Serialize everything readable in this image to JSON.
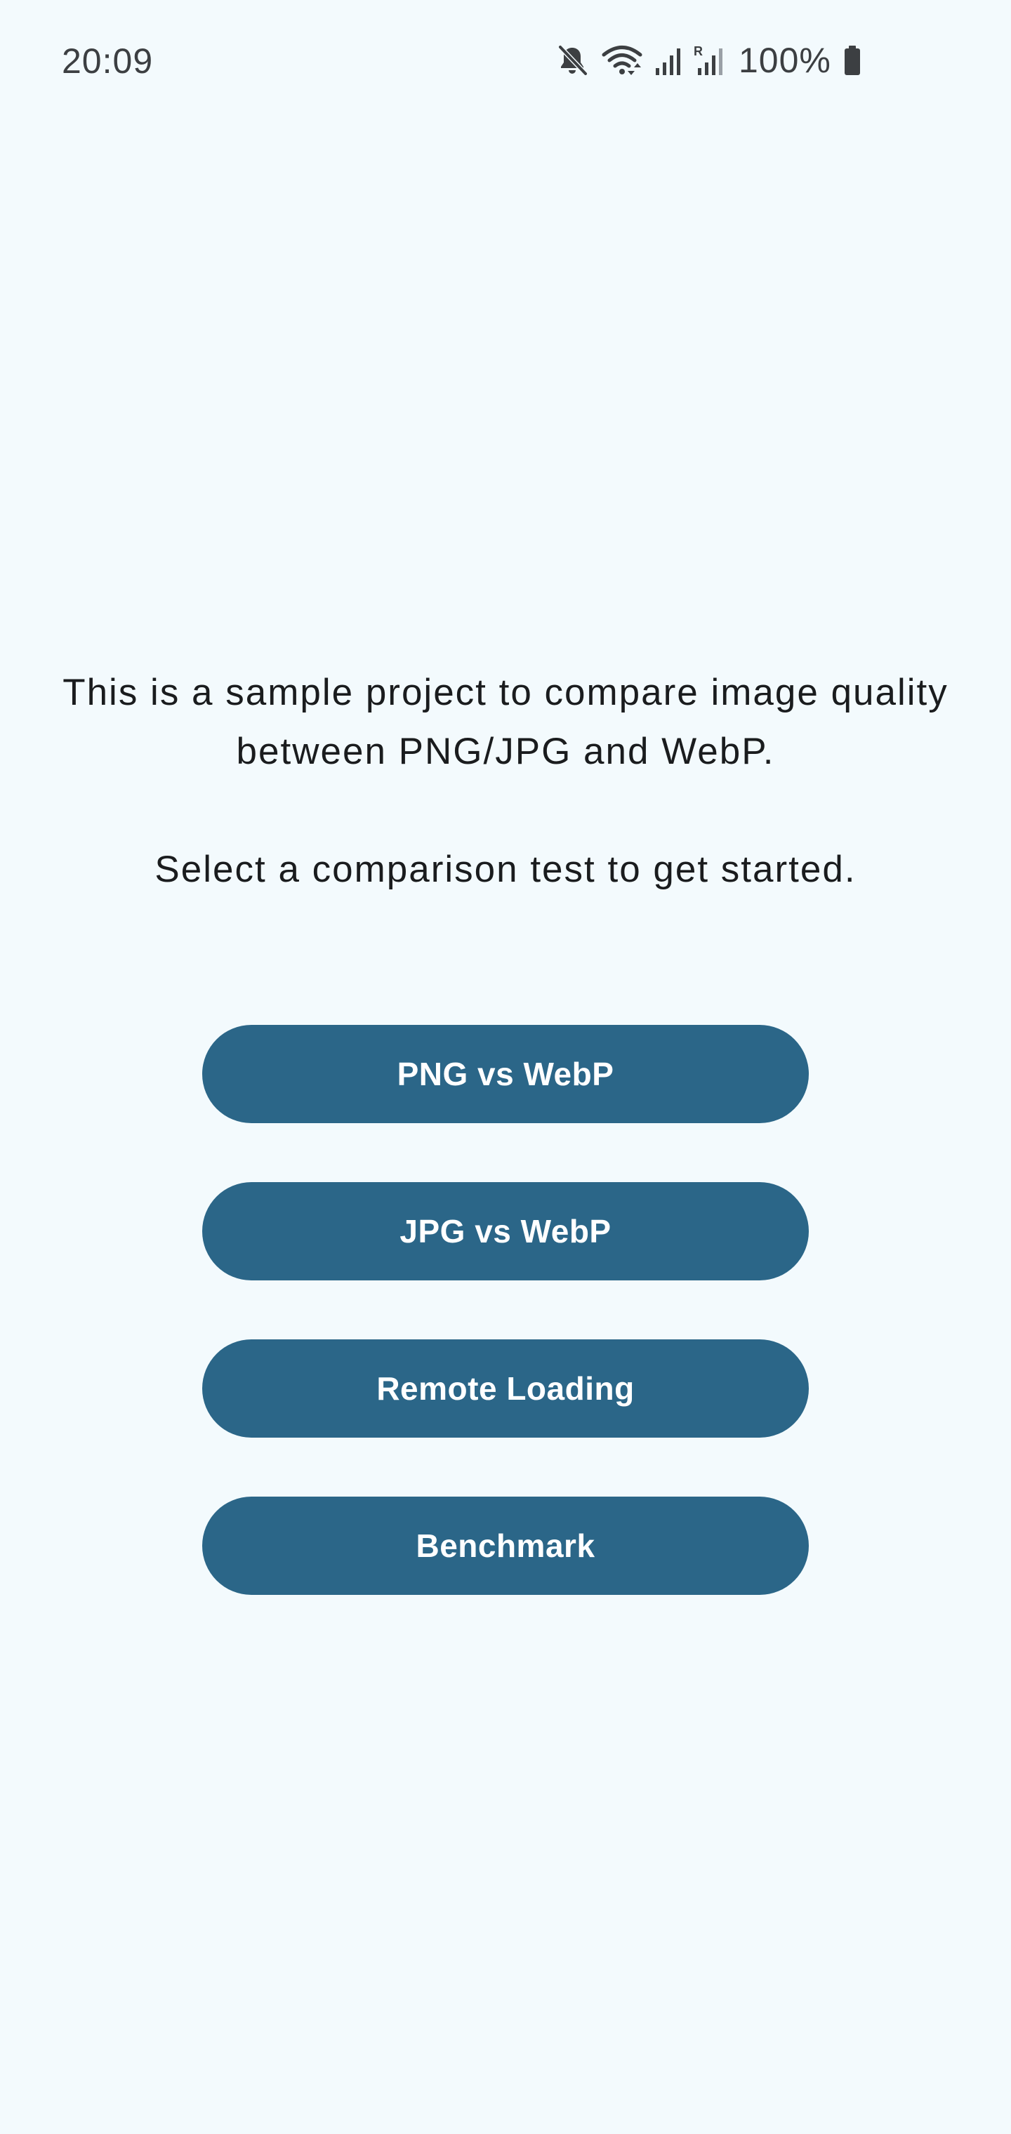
{
  "status_bar": {
    "time": "20:09",
    "battery": "100%",
    "icons": [
      "mute-icon",
      "wifi-icon",
      "signal-icon",
      "roaming-signal-icon",
      "battery-icon"
    ]
  },
  "intro": {
    "line1": "This is a sample project to compare image quality between PNG/JPG and WebP.",
    "line2": "Select a comparison test to get started."
  },
  "buttons": [
    {
      "label": "PNG vs WebP"
    },
    {
      "label": "JPG vs WebP"
    },
    {
      "label": "Remote Loading"
    },
    {
      "label": "Benchmark"
    }
  ],
  "colors": {
    "background": "#f3fafd",
    "button": "#2b6688",
    "button_text": "#ffffff",
    "text": "#1a1c1e",
    "status": "#3c3f42"
  }
}
